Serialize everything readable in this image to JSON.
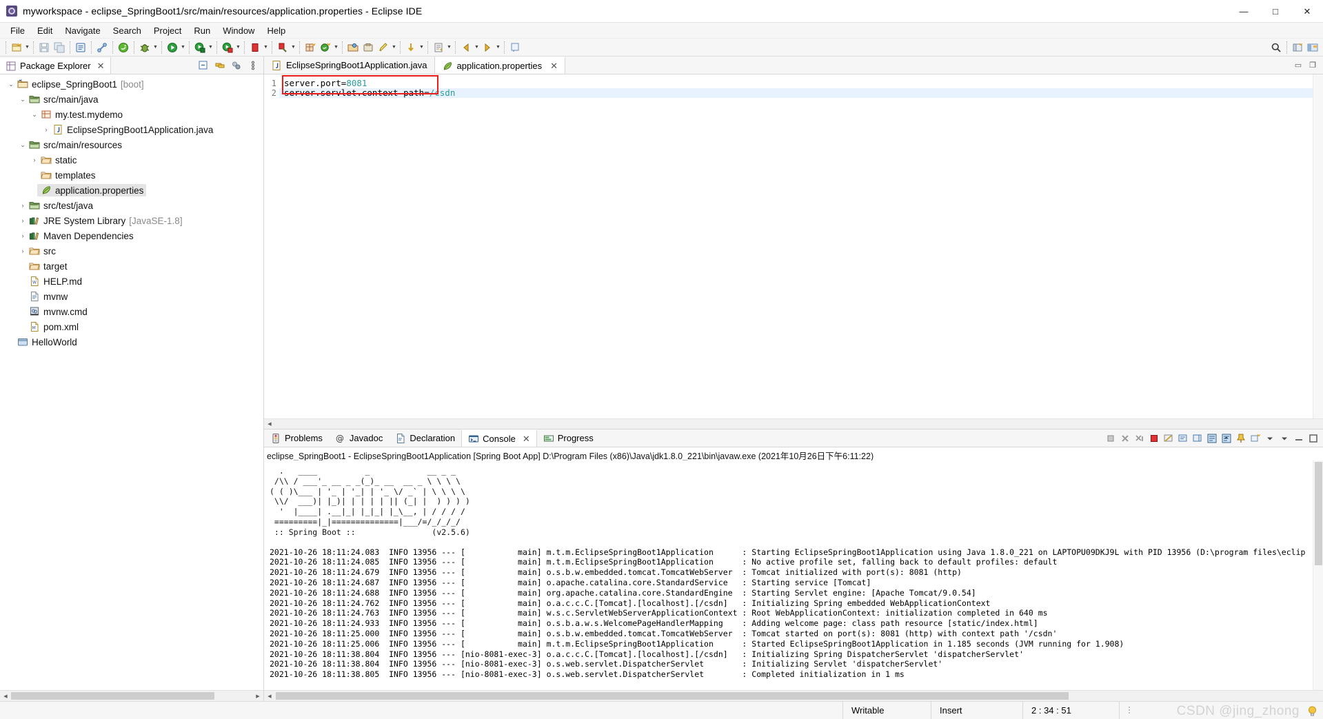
{
  "window": {
    "title": "myworkspace - eclipse_SpringBoot1/src/main/resources/application.properties - Eclipse IDE",
    "app_icon": "eclipse-icon",
    "minimize": "—",
    "maximize": "□",
    "close": "✕"
  },
  "menu": {
    "items": [
      {
        "label": "File"
      },
      {
        "label": "Edit"
      },
      {
        "label": "Navigate"
      },
      {
        "label": "Search"
      },
      {
        "label": "Project"
      },
      {
        "label": "Run"
      },
      {
        "label": "Window"
      },
      {
        "label": "Help"
      }
    ]
  },
  "toolbar": {
    "groups": [
      {
        "buttons": [
          {
            "icon": "new-wizard-icon",
            "dropdown": true
          }
        ]
      },
      {
        "buttons": [
          {
            "icon": "save-icon",
            "dropdown": false
          },
          {
            "icon": "save-all-icon",
            "dropdown": false
          }
        ]
      },
      {
        "buttons": [
          {
            "icon": "new-java-file-icon",
            "dropdown": false
          }
        ]
      },
      {
        "buttons": [
          {
            "icon": "link-icon",
            "dropdown": false
          }
        ]
      },
      {
        "buttons": [
          {
            "icon": "spring-boot-dashboard-icon",
            "dropdown": false
          }
        ]
      },
      {
        "buttons": [
          {
            "icon": "debug-icon",
            "dropdown": true
          }
        ]
      },
      {
        "buttons": [
          {
            "icon": "external-tools-icon",
            "dropdown": true
          }
        ]
      },
      {
        "buttons": [
          {
            "icon": "run-icon",
            "dropdown": true
          }
        ]
      },
      {
        "buttons": [
          {
            "icon": "run-last-icon",
            "dropdown": true
          }
        ]
      },
      {
        "buttons": [
          {
            "icon": "terminate-icon",
            "dropdown": true
          }
        ]
      },
      {
        "buttons": [
          {
            "icon": "stop-red-icon",
            "dropdown": true
          }
        ]
      },
      {
        "buttons": [
          {
            "icon": "new-package-icon",
            "dropdown": false
          },
          {
            "icon": "new-class-icon",
            "dropdown": true
          }
        ]
      },
      {
        "buttons": [
          {
            "icon": "open-type-icon",
            "dropdown": false
          },
          {
            "icon": "open-task-icon",
            "dropdown": false
          },
          {
            "icon": "edit-icon",
            "dropdown": true
          }
        ]
      },
      {
        "buttons": [
          {
            "icon": "next-annotation-icon",
            "dropdown": true
          }
        ]
      },
      {
        "buttons": [
          {
            "icon": "previous-edit-icon",
            "dropdown": true
          }
        ]
      },
      {
        "buttons": [
          {
            "icon": "back-icon",
            "dropdown": false
          },
          {
            "icon": "forward-icon",
            "dropdown": false
          }
        ]
      },
      {
        "buttons": [
          {
            "icon": "pin-editor-icon",
            "dropdown": false
          }
        ]
      }
    ],
    "right_buttons": [
      {
        "icon": "search-icon"
      },
      {
        "icon": "open-perspective-icon"
      },
      {
        "icon": "java-perspective-icon"
      }
    ]
  },
  "package_explorer": {
    "tab_label": "Package Explorer",
    "tab_icon": "package-explorer-icon",
    "close_icon": "✕",
    "tools": [
      {
        "icon": "collapse-all-icon"
      },
      {
        "icon": "link-with-editor-icon"
      },
      {
        "icon": "view-menu-filter-icon"
      },
      {
        "icon": "view-menu-icon"
      }
    ],
    "tree": [
      {
        "depth": 0,
        "twisty": "open",
        "icon": "project-boot-icon",
        "label": "eclipse_SpringBoot1",
        "suffix": "[boot]",
        "selected": false
      },
      {
        "depth": 1,
        "twisty": "open",
        "icon": "source-folder-icon",
        "label": "src/main/java",
        "suffix": "",
        "selected": false
      },
      {
        "depth": 2,
        "twisty": "open",
        "icon": "package-icon",
        "label": "my.test.mydemo",
        "suffix": "",
        "selected": false
      },
      {
        "depth": 3,
        "twisty": "closed",
        "icon": "java-file-icon",
        "label": "EclipseSpringBoot1Application.java",
        "suffix": "",
        "selected": false
      },
      {
        "depth": 1,
        "twisty": "open",
        "icon": "source-folder-icon",
        "label": "src/main/resources",
        "suffix": "",
        "selected": false
      },
      {
        "depth": 2,
        "twisty": "closed",
        "icon": "folder-icon",
        "label": "static",
        "suffix": "",
        "selected": false
      },
      {
        "depth": 2,
        "twisty": "none",
        "icon": "folder-icon",
        "label": "templates",
        "suffix": "",
        "selected": false
      },
      {
        "depth": 2,
        "twisty": "none",
        "icon": "properties-file-icon",
        "label": "application.properties",
        "suffix": "",
        "selected": true
      },
      {
        "depth": 1,
        "twisty": "closed",
        "icon": "source-folder-icon",
        "label": "src/test/java",
        "suffix": "",
        "selected": false
      },
      {
        "depth": 1,
        "twisty": "closed",
        "icon": "library-icon",
        "label": "JRE System Library",
        "suffix": "[JavaSE-1.8]",
        "selected": false
      },
      {
        "depth": 1,
        "twisty": "closed",
        "icon": "library-icon",
        "label": "Maven Dependencies",
        "suffix": "",
        "selected": false
      },
      {
        "depth": 1,
        "twisty": "closed",
        "icon": "folder-icon",
        "label": "src",
        "suffix": "",
        "selected": false
      },
      {
        "depth": 1,
        "twisty": "none",
        "icon": "folder-icon",
        "label": "target",
        "suffix": "",
        "selected": false
      },
      {
        "depth": 1,
        "twisty": "none",
        "icon": "md-file-icon",
        "label": "HELP.md",
        "suffix": "",
        "selected": false
      },
      {
        "depth": 1,
        "twisty": "none",
        "icon": "text-file-icon",
        "label": "mvnw",
        "suffix": "",
        "selected": false
      },
      {
        "depth": 1,
        "twisty": "none",
        "icon": "cmd-file-icon",
        "label": "mvnw.cmd",
        "suffix": "",
        "selected": false
      },
      {
        "depth": 1,
        "twisty": "none",
        "icon": "xml-file-icon",
        "label": "pom.xml",
        "suffix": "",
        "selected": false
      },
      {
        "depth": 0,
        "twisty": "none",
        "icon": "closed-project-icon",
        "label": "HelloWorld",
        "suffix": "",
        "selected": false
      }
    ]
  },
  "editor": {
    "tabs": [
      {
        "label": "EclipseSpringBoot1Application.java",
        "icon": "java-file-icon",
        "active": false,
        "closable": false
      },
      {
        "label": "application.properties",
        "icon": "properties-file-icon",
        "active": true,
        "closable": true
      }
    ],
    "lines": [
      {
        "num": "1",
        "prefix": "server.port=",
        "value": "8081",
        "current": false
      },
      {
        "num": "2",
        "prefix": "server.servlet.context-path=",
        "value": "/csdn",
        "current": true
      }
    ],
    "highlight_color": "#ee1b1b",
    "value_color": "#2a9c9c"
  },
  "console": {
    "tabs": [
      {
        "label": "Problems",
        "icon": "problems-icon",
        "active": false,
        "closable": false
      },
      {
        "label": "Javadoc",
        "icon": "javadoc-icon",
        "active": false,
        "closable": false
      },
      {
        "label": "Declaration",
        "icon": "declaration-icon",
        "active": false,
        "closable": false
      },
      {
        "label": "Console",
        "icon": "console-icon",
        "active": true,
        "closable": true
      },
      {
        "label": "Progress",
        "icon": "progress-icon",
        "active": false,
        "closable": false
      }
    ],
    "tools": [
      {
        "icon": "terminate-all-icon"
      },
      {
        "icon": "remove-launch-icon"
      },
      {
        "icon": "remove-all-terminated-icon"
      },
      {
        "icon": "stop-icon"
      },
      {
        "icon": "clear-console-icon"
      },
      {
        "icon": "display-selected-console-icon"
      },
      {
        "icon": "open-console-icon"
      },
      {
        "icon": "scroll-lock-icon"
      },
      {
        "icon": "word-wrap-icon"
      },
      {
        "icon": "pin-console-icon"
      },
      {
        "icon": "new-console-view-icon"
      },
      {
        "icon": "console-dropdown-icon"
      },
      {
        "icon": "view-menu-icon"
      },
      {
        "icon": "minimize-icon"
      },
      {
        "icon": "maximize-icon"
      }
    ],
    "header": "eclipse_SpringBoot1 - EclipseSpringBoot1Application [Spring Boot App] D:\\Program Files (x86)\\Java\\jdk1.8.0_221\\bin\\javaw.exe  (2021年10月26日下午6:11:22)",
    "banner": "  .   ____          _            __ _ _\n /\\\\ / ___'_ __ _ _(_)_ __  __ _ \\ \\ \\ \\\n( ( )\\___ | '_ | '_| | '_ \\/ _` | \\ \\ \\ \\\n \\\\/  ___)| |_)| | | | | || (_| |  ) ) ) )\n  '  |____| .__|_| |_|_| |_\\__, | / / / /\n =========|_|==============|___/=/_/_/_/",
    "banner_version": " :: Spring Boot ::                (v2.5.6)",
    "log": [
      "2021-10-26 18:11:24.083  INFO 13956 --- [           main] m.t.m.EclipseSpringBoot1Application      : Starting EclipseSpringBoot1Application using Java 1.8.0_221 on LAPTOPU09DKJ9L with PID 13956 (D:\\program files\\eclip",
      "2021-10-26 18:11:24.085  INFO 13956 --- [           main] m.t.m.EclipseSpringBoot1Application      : No active profile set, falling back to default profiles: default",
      "2021-10-26 18:11:24.679  INFO 13956 --- [           main] o.s.b.w.embedded.tomcat.TomcatWebServer  : Tomcat initialized with port(s): 8081 (http)",
      "2021-10-26 18:11:24.687  INFO 13956 --- [           main] o.apache.catalina.core.StandardService   : Starting service [Tomcat]",
      "2021-10-26 18:11:24.688  INFO 13956 --- [           main] org.apache.catalina.core.StandardEngine  : Starting Servlet engine: [Apache Tomcat/9.0.54]",
      "2021-10-26 18:11:24.762  INFO 13956 --- [           main] o.a.c.c.C.[Tomcat].[localhost].[/csdn]   : Initializing Spring embedded WebApplicationContext",
      "2021-10-26 18:11:24.763  INFO 13956 --- [           main] w.s.c.ServletWebServerApplicationContext : Root WebApplicationContext: initialization completed in 640 ms",
      "2021-10-26 18:11:24.933  INFO 13956 --- [           main] o.s.b.a.w.s.WelcomePageHandlerMapping    : Adding welcome page: class path resource [static/index.html]",
      "2021-10-26 18:11:25.000  INFO 13956 --- [           main] o.s.b.w.embedded.tomcat.TomcatWebServer  : Tomcat started on port(s): 8081 (http) with context path '/csdn'",
      "2021-10-26 18:11:25.006  INFO 13956 --- [           main] m.t.m.EclipseSpringBoot1Application      : Started EclipseSpringBoot1Application in 1.185 seconds (JVM running for 1.908)",
      "2021-10-26 18:11:38.804  INFO 13956 --- [nio-8081-exec-3] o.a.c.c.C.[Tomcat].[localhost].[/csdn]   : Initializing Spring DispatcherServlet 'dispatcherServlet'",
      "2021-10-26 18:11:38.804  INFO 13956 --- [nio-8081-exec-3] o.s.web.servlet.DispatcherServlet        : Initializing Servlet 'dispatcherServlet'",
      "2021-10-26 18:11:38.805  INFO 13956 --- [nio-8081-exec-3] o.s.web.servlet.DispatcherServlet        : Completed initialization in 1 ms"
    ]
  },
  "statusbar": {
    "writable": "Writable",
    "insert": "Insert",
    "position": "2 : 34 : 51",
    "watermark": "CSDN @jing_zhong"
  }
}
